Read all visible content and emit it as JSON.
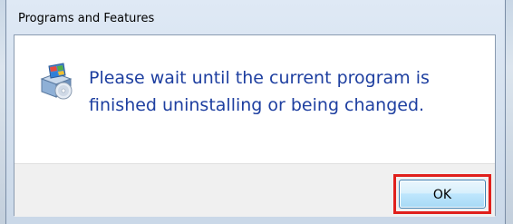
{
  "window": {
    "title": "Programs and Features"
  },
  "dialog": {
    "message": "Please wait until the current program is finished uninstalling or being changed.",
    "icon": "programs-features-icon"
  },
  "buttons": {
    "ok_label": "OK"
  },
  "colors": {
    "message_text": "#1e3fa0",
    "highlight_border": "#e0201c",
    "button_border": "#3c7fb1"
  }
}
